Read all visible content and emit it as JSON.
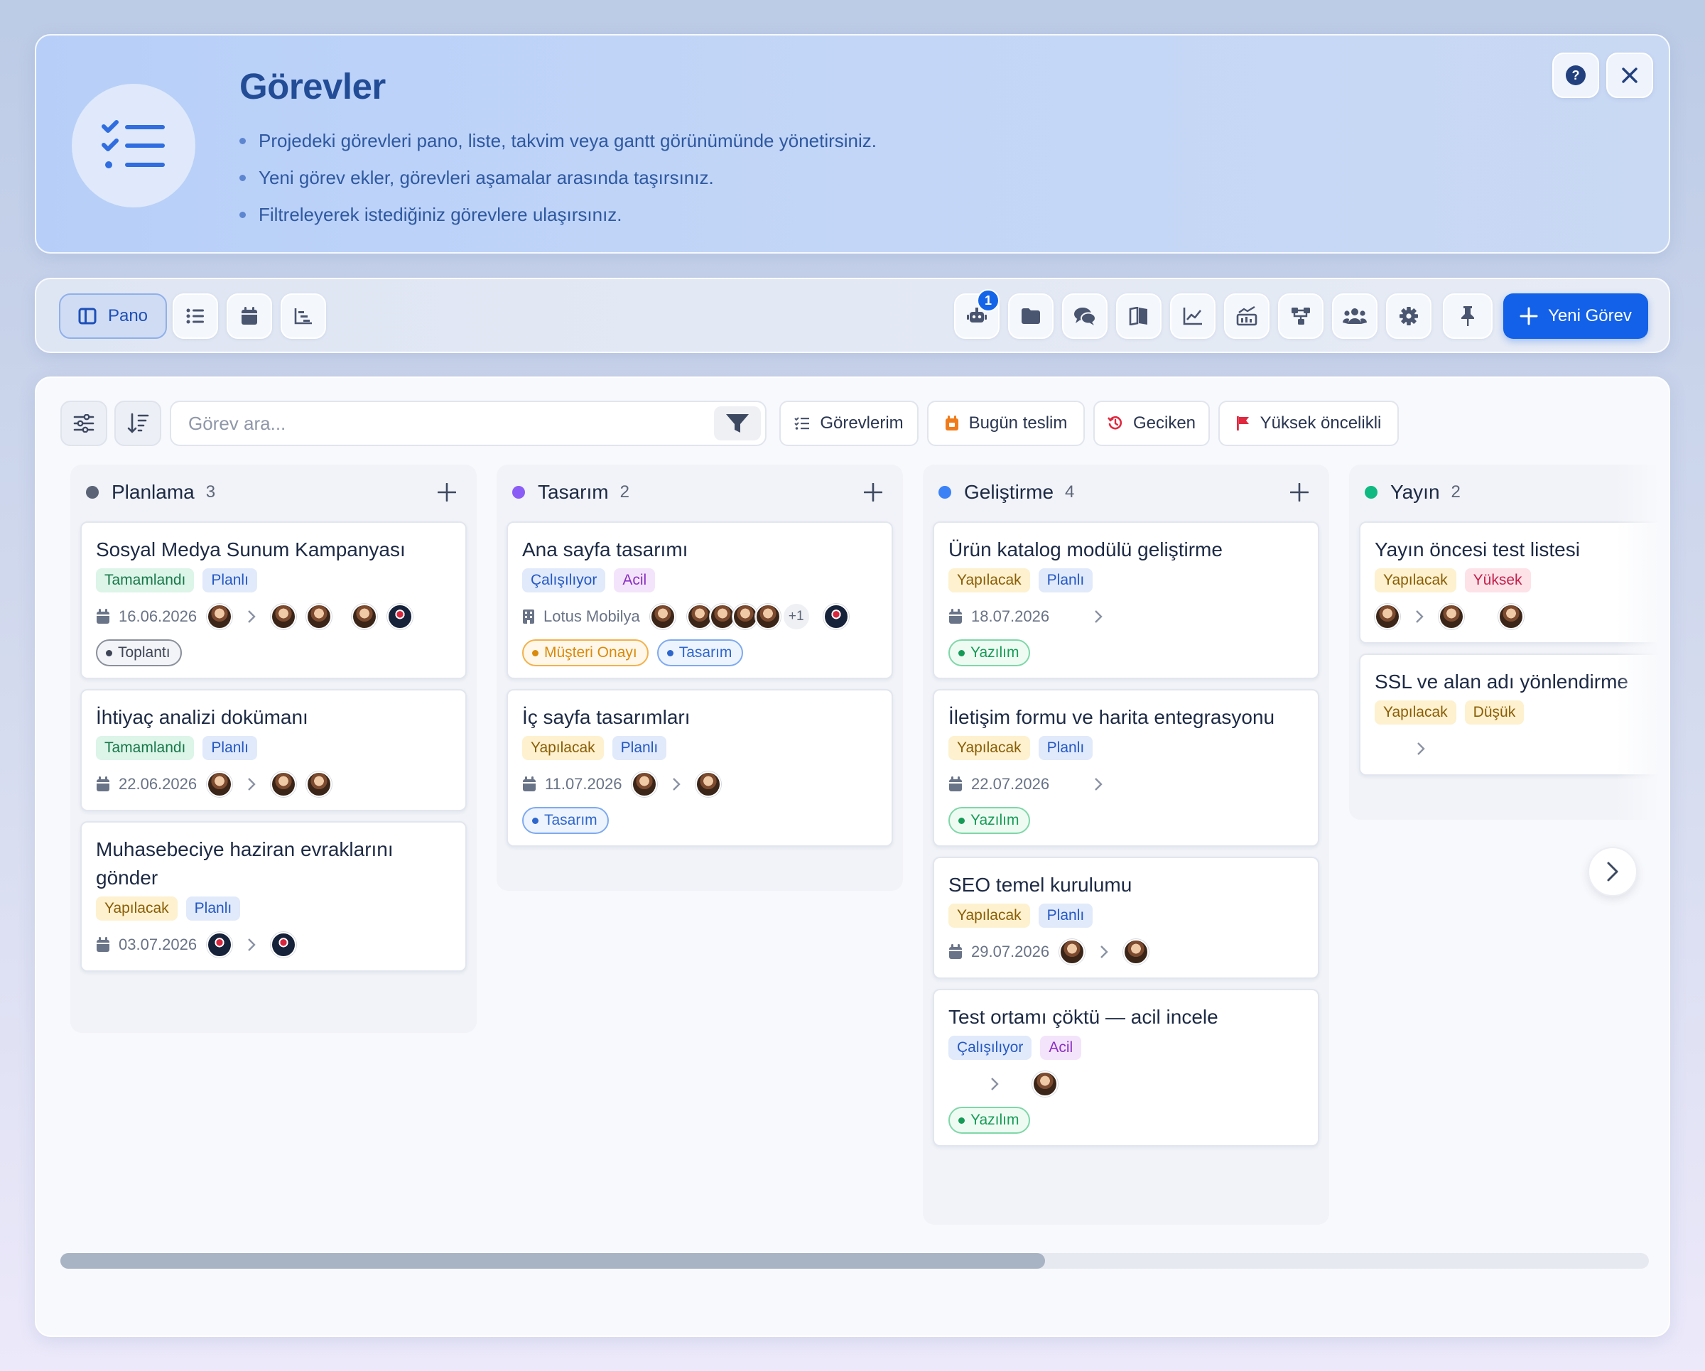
{
  "header": {
    "title": "Görevler",
    "bullets": [
      "Projedeki görevleri pano, liste, takvim veya gantt görünümünde yönetirsiniz.",
      "Yeni görev ekler, görevleri aşamalar arasında taşırsınız.",
      "Filtreleyerek istediğiniz görevlere ulaşırsınız."
    ],
    "icon": "tasks-checklist-icon"
  },
  "toolbar": {
    "views": [
      {
        "label": "Pano",
        "icon": "board-icon",
        "active": true
      },
      {
        "label": "",
        "icon": "list-icon"
      },
      {
        "label": "",
        "icon": "calendar-icon"
      },
      {
        "label": "",
        "icon": "gantt-icon"
      }
    ],
    "robot_badge": "1",
    "actions": [
      "robot-icon",
      "folder-icon",
      "chat-icon",
      "book-icon",
      "line-chart-icon",
      "chart-report-icon",
      "hierarchy-icon",
      "users-icon",
      "gear-icon",
      "pin-icon"
    ],
    "new_task_label": "Yeni Görev"
  },
  "filters": {
    "search_placeholder": "Görev ara...",
    "quick": [
      "Görevlerim",
      "Bugün teslim",
      "Geciken",
      "Yüksek öncelikli"
    ]
  },
  "columns": [
    {
      "name": "Planlama",
      "count": "3",
      "color": "#5b6476",
      "cards": [
        {
          "title": "Sosyal Medya Sunum Kampanyası",
          "tags": [
            "Tamamlandı",
            "Planlı"
          ],
          "date": "16.06.2026",
          "labels": [
            "Toplantı"
          ]
        },
        {
          "title": "İhtiyaç analizi dokümanı",
          "tags": [
            "Tamamlandı",
            "Planlı"
          ],
          "date": "22.06.2026"
        },
        {
          "title": "Muhasebeciye haziran evraklarını gönder",
          "tags": [
            "Yapılacak",
            "Planlı"
          ],
          "date": "03.07.2026"
        }
      ]
    },
    {
      "name": "Tasarım",
      "count": "2",
      "color": "#8b5cf6",
      "cards": [
        {
          "title": "Ana sayfa tasarımı",
          "tags": [
            "Çalışılıyor",
            "Acil"
          ],
          "customer": "Lotus Mobilya",
          "more": "+1",
          "labels": [
            "Müşteri Onayı",
            "Tasarım"
          ]
        },
        {
          "title": "İç sayfa tasarımları",
          "tags": [
            "Yapılacak",
            "Planlı"
          ],
          "date": "11.07.2026",
          "labels": [
            "Tasarım"
          ]
        }
      ]
    },
    {
      "name": "Geliştirme",
      "count": "4",
      "color": "#3b82f6",
      "cards": [
        {
          "title": "Ürün katalog modülü geliştirme",
          "tags": [
            "Yapılacak",
            "Planlı"
          ],
          "date": "18.07.2026",
          "labels": [
            "Yazılım"
          ]
        },
        {
          "title": "İletişim formu ve harita entegrasyonu",
          "tags": [
            "Yapılacak",
            "Planlı"
          ],
          "date": "22.07.2026",
          "labels": [
            "Yazılım"
          ]
        },
        {
          "title": "SEO temel kurulumu",
          "tags": [
            "Yapılacak",
            "Planlı"
          ],
          "date": "29.07.2026"
        },
        {
          "title": "Test ortamı çöktü — acil incele",
          "tags": [
            "Çalışılıyor",
            "Acil"
          ],
          "labels": [
            "Yazılım"
          ]
        }
      ]
    },
    {
      "name": "Yayın",
      "count": "2",
      "color": "#10b981",
      "cards": [
        {
          "title": "Yayın öncesi test listesi",
          "tags": [
            "Yapılacak",
            "Yüksek"
          ]
        },
        {
          "title": "SSL ve alan adı yönlendirme",
          "tags": [
            "Yapılacak",
            "Düşük"
          ]
        }
      ]
    }
  ],
  "horizontal_scroll": {
    "position": 0.62
  }
}
